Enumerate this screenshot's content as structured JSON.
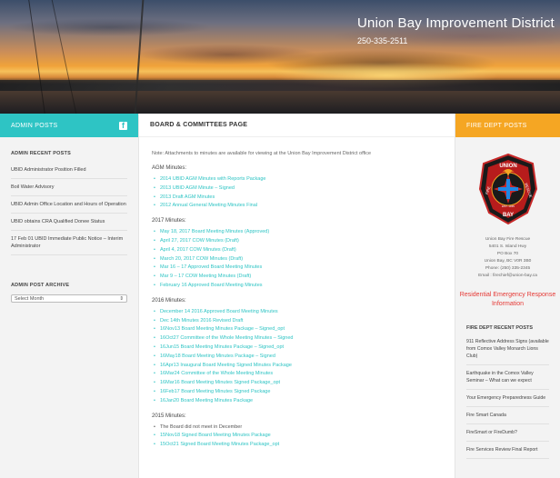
{
  "header": {
    "site_title": "Union Bay Improvement District",
    "phone": "250-335-2511"
  },
  "left": {
    "bar_label": "ADMIN POSTS",
    "recent_title": "ADMIN RECENT POSTS",
    "recent_posts": [
      "UBID Administrator Position Filled",
      "Boil Water Advisory",
      "UBID Admin Office Location and Hours of Operation",
      "UBID obtains CRA Qualified Donee Status",
      "17 Feb 01 UBID Immediate Public Notice – Interim Administrator"
    ],
    "archive_title": "ADMIN POST ARCHIVE",
    "archive_select": "Select Month",
    "accent": "#2ec4c4"
  },
  "main": {
    "page_title": "BOARD & COMMITTEES PAGE",
    "note": "Note: Attachments to minutes are available for viewing at the Union Bay Improvement District office",
    "sections": [
      {
        "heading": "AGM Minutes:",
        "items": [
          "2014 UBID AGM Minutes with Reports Package",
          "2013 UBID AGM Minute – Signed",
          "2013 Draft AGM Minutes",
          "2012 Annual General Meeting Minutes Final"
        ]
      },
      {
        "heading": "2017 Minutes:",
        "items": [
          "May 18, 2017 Board Meeting Minutes (Approved)",
          "April 27, 2017 COW Minutes (Draft)",
          "April 4, 2017 COW Minutes (Draft)",
          "March 20, 2017 COW Minutes (Draft)",
          "Mar 16 – 17 Approved Board Meeting Minutes",
          "Mar 9 – 17 COW Meeting Minutes (Draft)",
          "February 16 Approved Board Meeting Minutes"
        ]
      },
      {
        "heading": "2016 Minutes:",
        "items": [
          "December 14 2016 Approved Board Meeting Minutes",
          "Dec 14th Minutes 2016 Revised Draft",
          "16Nov13 Board Meeting Minutes Package – Signed_opt",
          "16Oct27 Committee of the Whole Meeting Minutes – Signed",
          "16Jun15 Board Meeting Minutes Package – Signed_opt",
          "16May18 Board Meeting Minutes Package – Signed",
          "16Apr13 Inaugural Board Meeting Signed Minutes Package",
          "16Mar24 Committee of the Whole Meeting Minutes",
          "16Mar16 Board Meeting Minutes Signed Package_opt",
          "16Feb17 Board Meeting Minutes Signed Package",
          "16Jan20 Board Meeting Minutes Package"
        ]
      },
      {
        "heading": "2015 Minutes:",
        "plain_first": "The Board did not meet in December",
        "items": [
          "15Nov18 Signed Board Meeting Minutes Package",
          "15Oct21 Signed Board Meeting Minutes Package_opt"
        ]
      }
    ]
  },
  "right": {
    "bar_label": "FIRE DEPT POSTS",
    "badge": {
      "top": "UNION",
      "left": "FIRE",
      "right": "RESCUE",
      "bottom": "BAY",
      "est": "EST. 1935"
    },
    "address": [
      "Union Bay Fire Rescue",
      "5401 S. Island Hwy",
      "PO Box 70",
      "Union Bay, BC V0R 3B0",
      "Phone: (250) 335-2345",
      "Email : firechief@union-bay.ca"
    ],
    "residential": "Residential Emergency Response Information",
    "recent_title": "FIRE DEPT RECENT POSTS",
    "recent_posts": [
      "911 Reflective Address Signs (available from Comox Valley Monarch Lions Club)",
      "Earthquake in the Comox Valley Seminar – What can we expect",
      "Your Emergency Preparedness Guide",
      "Fire Smart Canada",
      "FireSmart or FireDumb?",
      "Fire Services Review Final Report"
    ],
    "accent": "#f5a623",
    "alert_color": "#e53935"
  }
}
